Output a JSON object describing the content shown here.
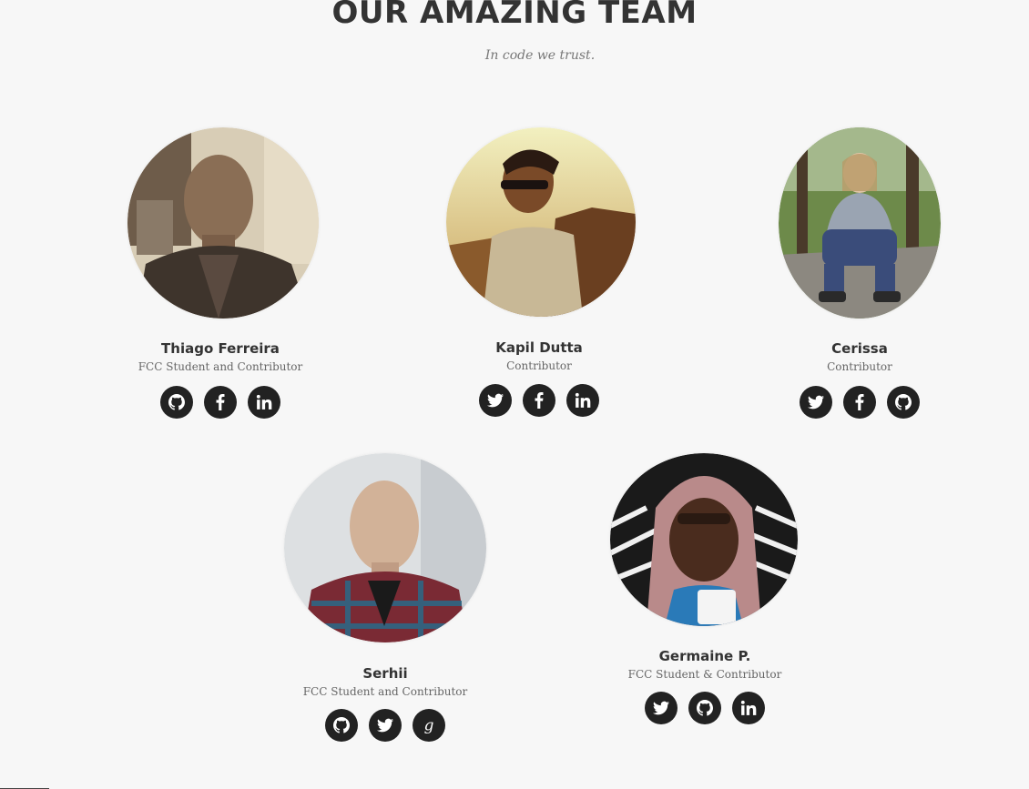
{
  "section": {
    "title": "OUR AMAZING TEAM",
    "subtitle": "In code we trust."
  },
  "members": [
    {
      "name": "Thiago Ferreira",
      "role": "FCC Student and Contributor",
      "socials": [
        "github-icon",
        "facebook-icon",
        "linkedin-icon"
      ]
    },
    {
      "name": "Kapil Dutta",
      "role": "Contributor",
      "socials": [
        "twitter-icon",
        "facebook-icon",
        "linkedin-icon"
      ]
    },
    {
      "name": "Cerissa",
      "role": "Contributor",
      "socials": [
        "twitter-icon",
        "facebook-icon",
        "github-icon"
      ]
    },
    {
      "name": "Serhii",
      "role": "FCC Student and Contributor",
      "socials": [
        "github-icon",
        "twitter-icon",
        "google-plus-icon"
      ]
    },
    {
      "name": "Germaine P.",
      "role": "FCC Student & Contributor",
      "socials": [
        "twitter-icon",
        "github-icon",
        "linkedin-icon"
      ]
    }
  ],
  "colors": {
    "background": "#f7f7f7",
    "heading": "#333333",
    "icon_circle": "#222222",
    "icon_glyph": "#ffffff"
  }
}
